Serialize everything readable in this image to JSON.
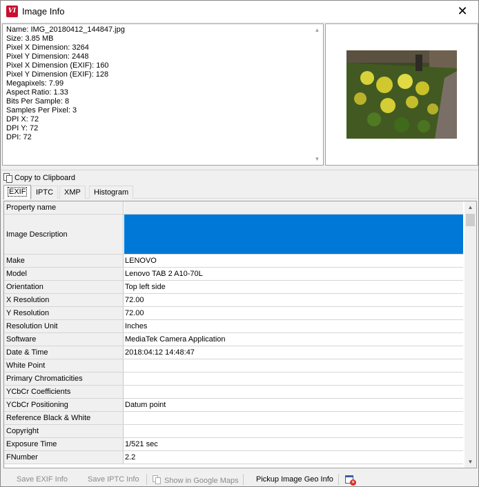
{
  "window": {
    "title": "Image Info",
    "app_icon_text": "VI",
    "close_glyph": "✕"
  },
  "info": {
    "lines": [
      "Name: IMG_20180412_144847.jpg",
      "Size: 3.85 MB",
      "Pixel X Dimension: 3264",
      "Pixel Y Dimension: 2448",
      "Pixel X Dimension (EXIF): 160",
      "Pixel Y Dimension (EXIF): 128",
      "Megapixels: 7.99",
      "Aspect Ratio: 1.33",
      "Bits Per Sample: 8",
      "Samples Per Pixel: 3",
      "DPI X: 72",
      "DPI Y: 72",
      "DPI: 72"
    ]
  },
  "clipboard": {
    "label": "Copy to Clipboard"
  },
  "tabs": [
    {
      "label": "EXIF"
    },
    {
      "label": "IPTC"
    },
    {
      "label": "XMP"
    },
    {
      "label": "Histogram"
    }
  ],
  "grid": {
    "header": {
      "name": "Property name",
      "value": ""
    },
    "rows": [
      {
        "name": "Image Description",
        "value": ""
      },
      {
        "name": "Make",
        "value": "LENOVO"
      },
      {
        "name": "Model",
        "value": "Lenovo TAB 2 A10-70L"
      },
      {
        "name": "Orientation",
        "value": "Top left side"
      },
      {
        "name": "X Resolution",
        "value": "72.00"
      },
      {
        "name": "Y Resolution",
        "value": "72.00"
      },
      {
        "name": "Resolution Unit",
        "value": "Inches"
      },
      {
        "name": "Software",
        "value": "MediaTek Camera Application"
      },
      {
        "name": "Date & Time",
        "value": "2018:04:12 14:48:47"
      },
      {
        "name": "White Point",
        "value": ""
      },
      {
        "name": "Primary Chromaticities",
        "value": ""
      },
      {
        "name": "YCbCr Coefficients",
        "value": ""
      },
      {
        "name": "YCbCr Positioning",
        "value": "Datum point"
      },
      {
        "name": "Reference Black & White",
        "value": ""
      },
      {
        "name": "Copyright",
        "value": ""
      },
      {
        "name": "Exposure Time",
        "value": "1/521 sec"
      },
      {
        "name": "FNumber",
        "value": "2.2"
      }
    ]
  },
  "toolbar": {
    "save_exif": "Save EXIF Info",
    "save_iptc": "Save IPTC Info",
    "show_maps": "Show in Google Maps",
    "pickup_geo": "Pickup Image Geo Info"
  },
  "colors": {
    "selection": "#0078d7",
    "app_icon": "#c8102e"
  }
}
